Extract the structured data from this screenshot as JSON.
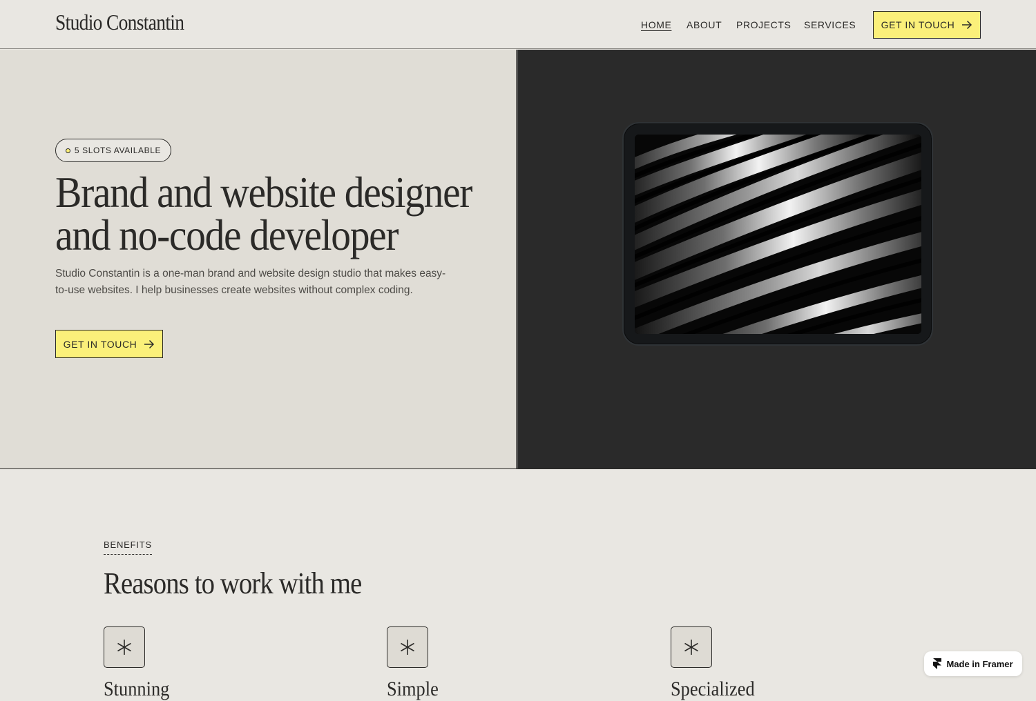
{
  "header": {
    "logo": "Studio Constantin",
    "nav": [
      "HOME",
      "ABOUT",
      "PROJECTS",
      "SERVICES"
    ],
    "active_nav": "HOME",
    "cta": "GET IN TOUCH"
  },
  "hero": {
    "badge": "5 SLOTS AVAILABLE",
    "title_line1": "Brand and website designer",
    "title_line2": "and no-code developer",
    "description": "Studio Constantin is a one-man brand and website design studio that makes easy-to-use websites. I help businesses create websites without complex coding.",
    "cta": "GET IN TOUCH"
  },
  "benefits": {
    "eyebrow": "BENEFITS",
    "title": "Reasons to work with me",
    "items": [
      {
        "title": "Stunning",
        "icon": "asterisk-icon"
      },
      {
        "title": "Simple",
        "icon": "asterisk-icon"
      },
      {
        "title": "Specialized",
        "icon": "asterisk-icon"
      }
    ]
  },
  "framer_badge": "Made in Framer",
  "colors": {
    "accent": "#fbf07a",
    "background": "#e9e7e2",
    "hero_left": "#e0ddd6",
    "hero_right": "#2a2a2a",
    "text": "#2b2a28"
  }
}
